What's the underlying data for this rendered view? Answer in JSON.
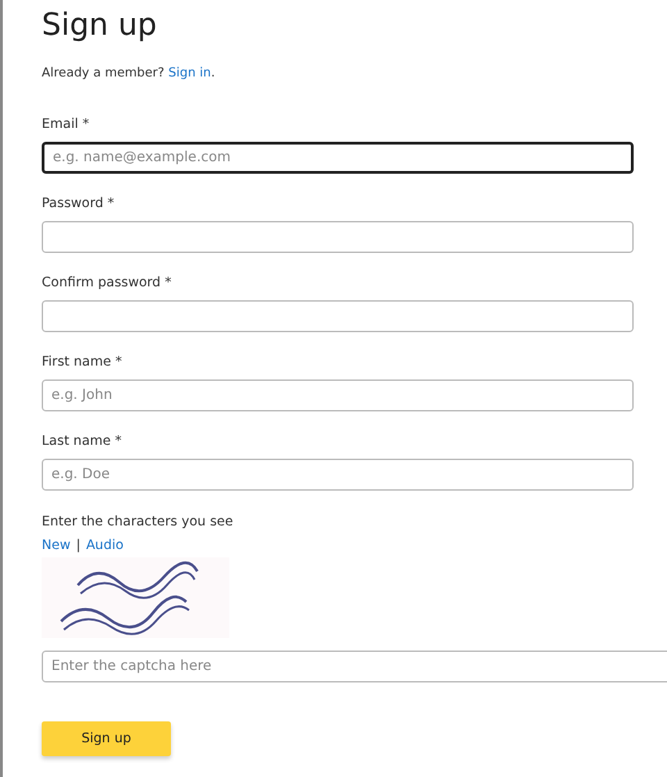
{
  "title": "Sign up",
  "member_prompt": {
    "text": "Already a member?",
    "link": "Sign in",
    "after": "."
  },
  "fields": [
    {
      "label": "Email *",
      "placeholder": "e.g. name@example.com",
      "focused": true
    },
    {
      "label": "Password *",
      "focused": false
    },
    {
      "label": "Confirm password *",
      "focused": false
    },
    {
      "label": "First name *",
      "placeholder": "e.g. John",
      "focused": false
    },
    {
      "label": "Last name *",
      "placeholder": "e.g. Doe",
      "focused": false
    }
  ],
  "captcha": {
    "label": "Enter the characters you see",
    "links": [
      "New",
      "Audio"
    ],
    "separator": "|",
    "placeholder": "Enter the captcha here"
  },
  "submit": "Sign up"
}
